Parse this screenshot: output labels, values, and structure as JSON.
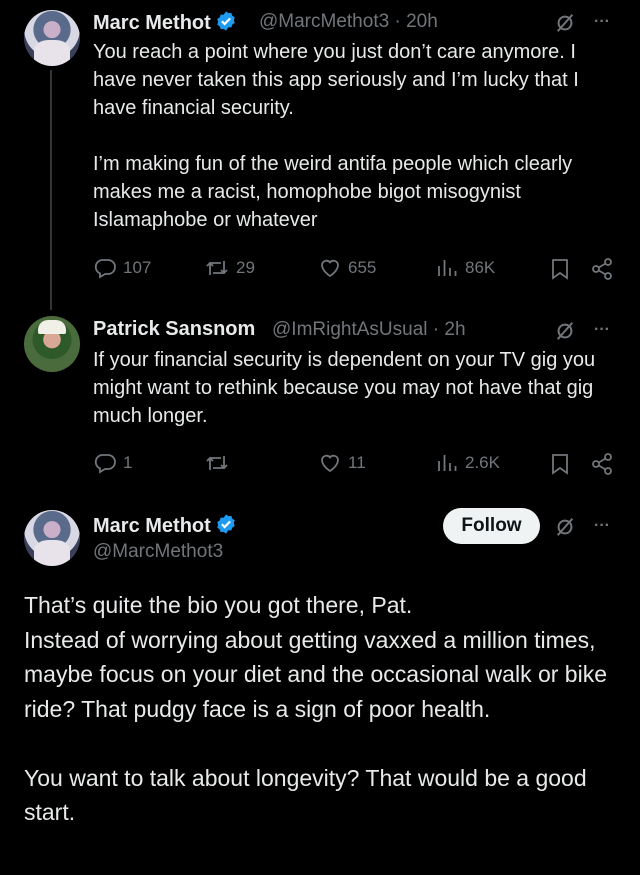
{
  "tweets": [
    {
      "name": "Marc Methot",
      "handle": "@MarcMethot3",
      "time": "20h",
      "text": [
        "You reach a point where you just don’t care anymore. I have never taken this app seriously and I’m lucky that I have financial security.",
        "I’m making fun of the weird antifa people which clearly makes me a racist, homophobe bigot misogynist Islamaphobe or whatever"
      ],
      "replies": "107",
      "reposts": "29",
      "likes": "655",
      "views": "86K",
      "verified": true
    },
    {
      "name": "Patrick Sansnom",
      "handle": "@ImRightAsUsual",
      "time": "2h",
      "text": [
        "If your financial security is dependent on your TV gig you might want to rethink because you may not have that gig much longer."
      ],
      "replies": "1",
      "reposts": "",
      "likes": "11",
      "views": "2.6K",
      "verified": false
    }
  ],
  "focused": {
    "name": "Marc Methot",
    "handle": "@MarcMethot3",
    "follow_label": "Follow",
    "verified": true,
    "paragraphs": [
      "That’s quite the bio you got there, Pat.",
      "Instead of worrying about getting vaxxed a million times, maybe focus on your diet and the occasional walk or bike ride? That pudgy face is a sign of poor health.",
      "You want to talk about longevity? That would be a good start."
    ]
  },
  "separator": "·",
  "more_glyph": "···",
  "colors": {
    "verified": "#1d9bf0",
    "muted": "#71767b",
    "text": "#e7e9ea",
    "background": "#000000"
  },
  "icons": [
    "verified-badge-icon",
    "grok-slash-icon",
    "more-icon",
    "reply-icon",
    "repost-icon",
    "like-icon",
    "views-icon",
    "bookmark-icon",
    "share-icon"
  ]
}
